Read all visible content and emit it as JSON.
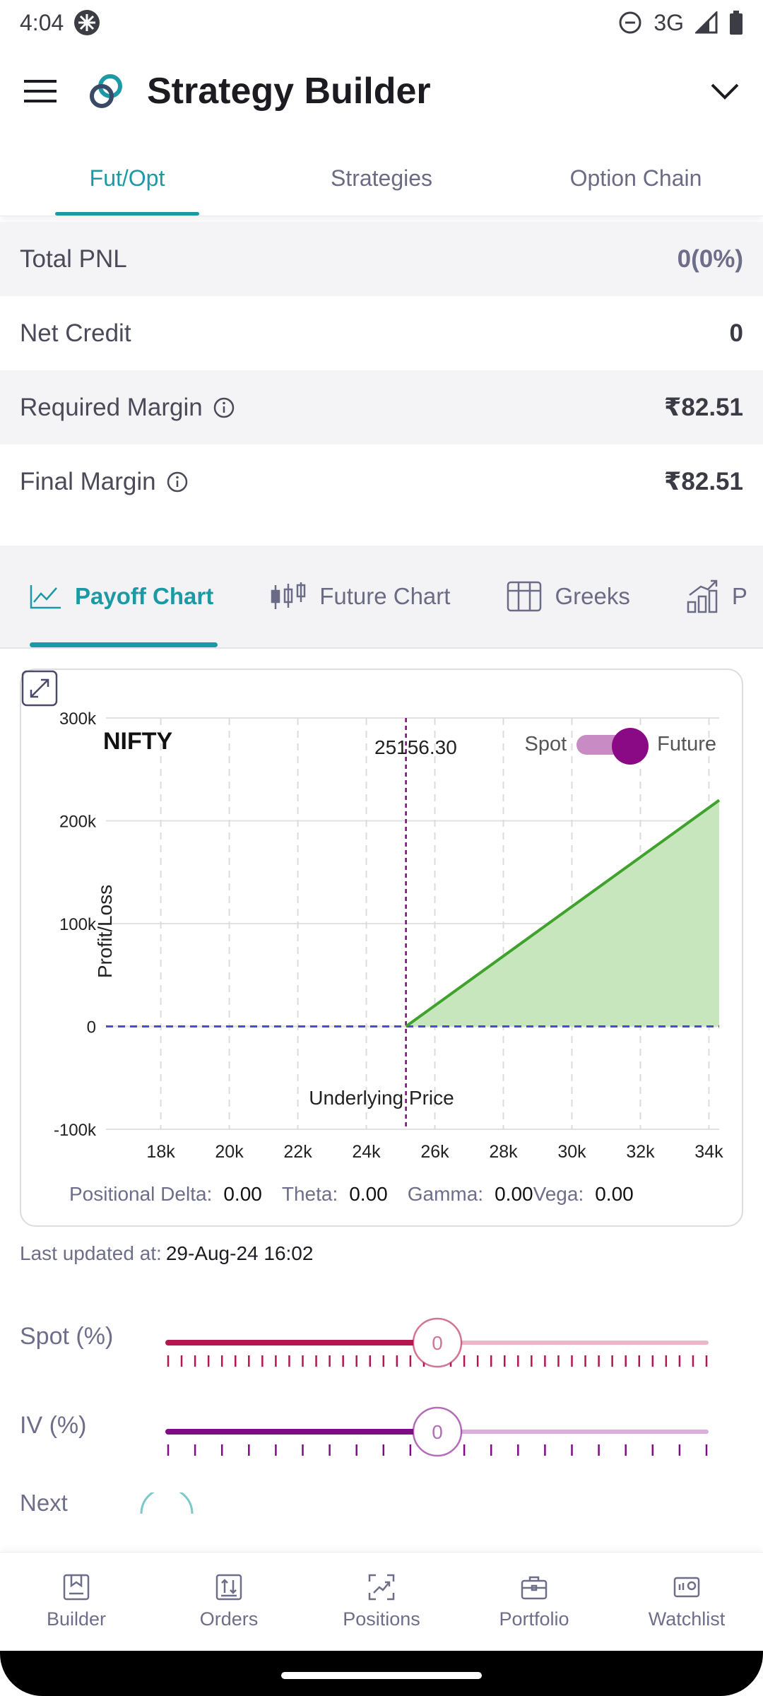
{
  "status_bar": {
    "time": "4:04",
    "network": "3G"
  },
  "app_bar": {
    "title": "Strategy Builder"
  },
  "top_tabs": [
    {
      "label": "Fut/Opt",
      "active": true
    },
    {
      "label": "Strategies",
      "active": false
    },
    {
      "label": "Option Chain",
      "active": false
    }
  ],
  "summary": {
    "total_pnl": {
      "label": "Total PNL",
      "value": "0(0%)"
    },
    "net_credit": {
      "label": "Net Credit",
      "value": "0"
    },
    "required_margin": {
      "label": "Required Margin",
      "value": "₹82.51"
    },
    "final_margin": {
      "label": "Final Margin",
      "value": "₹82.51"
    }
  },
  "chart_tabs": [
    {
      "label": "Payoff Chart",
      "icon": "line-chart-icon",
      "active": true
    },
    {
      "label": "Future Chart",
      "icon": "candlestick-icon",
      "active": false
    },
    {
      "label": "Greeks",
      "icon": "table-grid-icon",
      "active": false
    },
    {
      "label": "P",
      "icon": "bar-growth-icon",
      "active": false
    }
  ],
  "chart": {
    "symbol": "NIFTY",
    "spot_value": "25156.30",
    "toggle": {
      "left_label": "Spot",
      "right_label": "Future",
      "selected": "Future"
    },
    "colors": {
      "payoff_line": "#3ea22b",
      "payoff_fill": "#c7e6bd",
      "zero_line": "#4b4bdb",
      "spot_line": "#7a0a7a"
    }
  },
  "chart_data": {
    "type": "area",
    "ylabel": "Profit/Loss",
    "xlabel": "Underlying Price",
    "x_ticks": [
      "18k",
      "20k",
      "22k",
      "24k",
      "26k",
      "28k",
      "30k",
      "32k",
      "34k"
    ],
    "y_ticks": [
      "300k",
      "200k",
      "100k",
      "0",
      "-100k"
    ],
    "xlim": [
      16400,
      34300
    ],
    "ylim": [
      -100000,
      300000
    ],
    "spot_marker": 25156.3,
    "grid": true,
    "series": [
      {
        "x": [
          16400,
          25156.3,
          34300
        ],
        "y": [
          0,
          0,
          220000
        ]
      }
    ]
  },
  "greeks": [
    {
      "label": "Positional Delta:",
      "value": "0.00"
    },
    {
      "label": "Theta:",
      "value": "0.00"
    },
    {
      "label": "Gamma:",
      "value": "0.00"
    },
    {
      "label": "Vega:",
      "value": "0.00"
    }
  ],
  "last_updated": {
    "label": "Last updated at:",
    "value": "29-Aug-24 16:02"
  },
  "sliders": {
    "spot": {
      "label": "Spot (%)",
      "value": "0",
      "level": 0.5,
      "color": "#b5164f",
      "light": "#ebb6c8"
    },
    "iv": {
      "label": "IV (%)",
      "value": "0",
      "level": 0.5,
      "color": "#800b87",
      "light": "#dcaede"
    },
    "next": {
      "label": "Next"
    }
  },
  "bottom_nav": [
    {
      "label": "Builder",
      "icon": "builder-icon"
    },
    {
      "label": "Orders",
      "icon": "orders-icon"
    },
    {
      "label": "Positions",
      "icon": "positions-icon"
    },
    {
      "label": "Portfolio",
      "icon": "portfolio-icon"
    },
    {
      "label": "Watchlist",
      "icon": "watchlist-icon"
    }
  ]
}
